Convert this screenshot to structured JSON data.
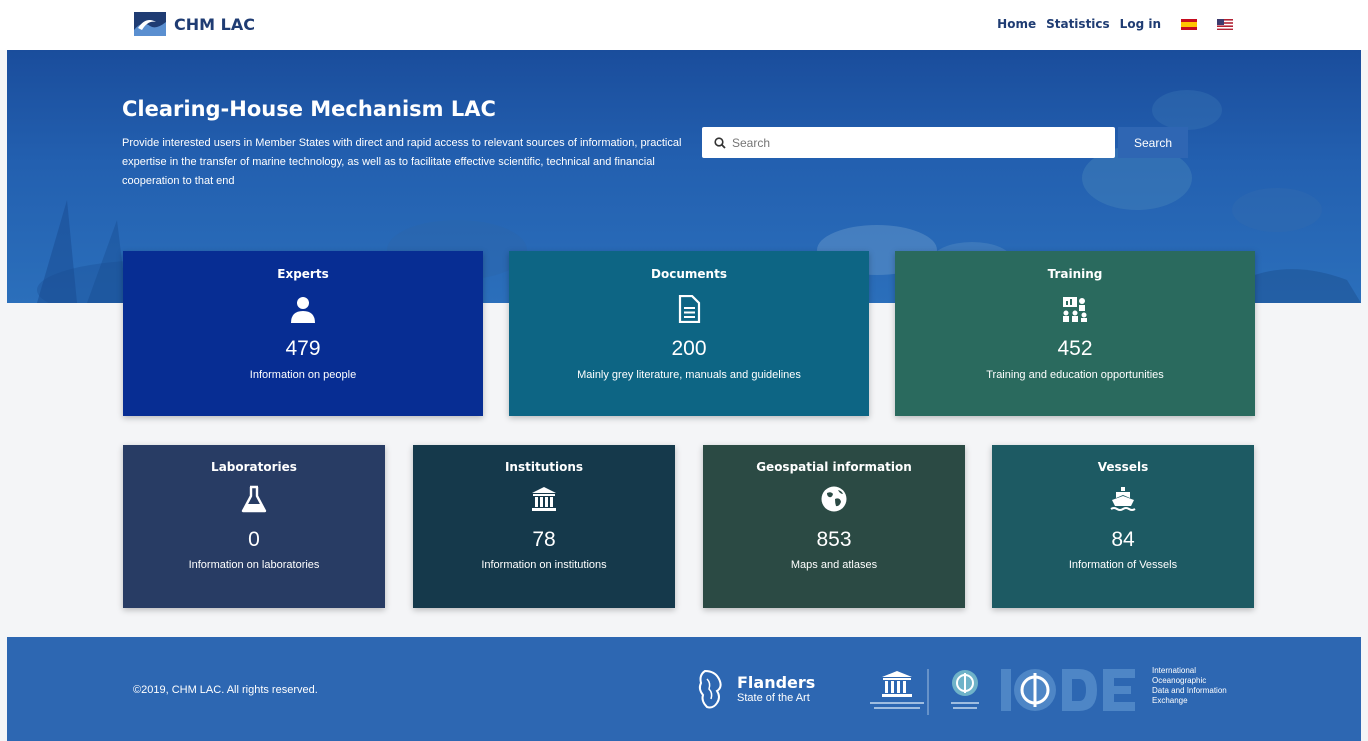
{
  "header": {
    "brand": "CHM LAC",
    "nav": [
      "Home",
      "Statistics",
      "Log in"
    ],
    "flags": [
      "es-flag",
      "us-flag"
    ]
  },
  "hero": {
    "title": "Clearing-House Mechanism LAC",
    "description": "Provide interested users in Member States with direct and rapid access to relevant sources of information, practical expertise in the transfer of marine technology, as well as to facilitate effective scientific, technical and financial cooperation to that end",
    "search_placeholder": "Search",
    "search_button": "Search"
  },
  "cards": [
    {
      "title": "Experts",
      "icon": "person-icon",
      "count": "479",
      "desc": "Information on people",
      "color": "#072d93"
    },
    {
      "title": "Documents",
      "icon": "document-icon",
      "count": "200",
      "desc": "Mainly grey literature, manuals and guidelines",
      "color": "#0d6584"
    },
    {
      "title": "Training",
      "icon": "training-icon",
      "count": "452",
      "desc": "Training and education opportunities",
      "color": "#2a6a5e"
    },
    {
      "title": "Laboratories",
      "icon": "flask-icon",
      "count": "0",
      "desc": "Information on laboratories",
      "color": "#283c64"
    },
    {
      "title": "Institutions",
      "icon": "institution-icon",
      "count": "78",
      "desc": "Information on institutions",
      "color": "#15394b"
    },
    {
      "title": "Geospatial information",
      "icon": "globe-icon",
      "count": "853",
      "desc": "Maps and atlases",
      "color": "#2b4a44"
    },
    {
      "title": "Vessels",
      "icon": "ship-icon",
      "count": "84",
      "desc": "Information of Vessels",
      "color": "#1d5a63"
    }
  ],
  "footer": {
    "copyright": "©2019, CHM LAC. All rights reserved.",
    "flanders_name": "Flanders",
    "flanders_sub": "State of the Art",
    "iode_text": [
      "International",
      "Oceanographic",
      "Data and Information",
      "Exchange"
    ]
  },
  "colors": {
    "nav_text": "#1f3c73",
    "hero_bg": "#2360b0",
    "footer_bg": "#2d67b2",
    "search_button": "#2f66b3"
  }
}
